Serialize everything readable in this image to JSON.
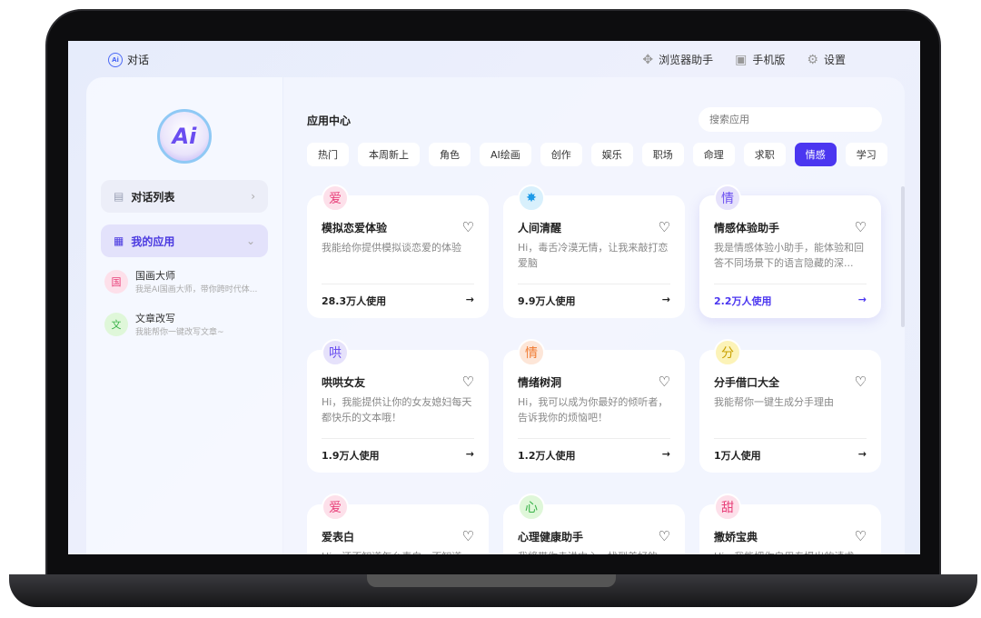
{
  "header": {
    "title": "对话",
    "logo_text": "Ai",
    "links": [
      {
        "label": "浏览器助手",
        "icon": "puzzle-icon"
      },
      {
        "label": "手机版",
        "icon": "phone-icon"
      },
      {
        "label": "设置",
        "icon": "gear-icon"
      }
    ]
  },
  "sidebar": {
    "logo_text": "Ai",
    "chat_list": "对话列表",
    "my_apps": "我的应用",
    "apps": [
      {
        "avatar": "国",
        "name": "国画大师",
        "desc": "我是AI国画大师，带你跨时代体...",
        "bg": "#fde0ea",
        "color": "#e8407a"
      },
      {
        "avatar": "文",
        "name": "文章改写",
        "desc": "我能帮你一键改写文章~",
        "bg": "#dff7d9",
        "color": "#3bb34a"
      }
    ]
  },
  "main": {
    "title": "应用中心",
    "search_placeholder": "搜索应用",
    "categories": [
      "热门",
      "本周新上",
      "角色",
      "AI绘画",
      "创作",
      "娱乐",
      "职场",
      "命理",
      "求职",
      "情感",
      "学习"
    ],
    "active_category": "情感",
    "cards": [
      {
        "icon": "爱",
        "bg": "#fde0ea",
        "color": "#e8407a",
        "title": "模拟恋爱体验",
        "desc": "我能给你提供模拟谈恋爱的体验",
        "usage": "28.3万人使用"
      },
      {
        "icon": "✸",
        "bg": "#d8f0fc",
        "color": "#1e9be8",
        "title": "人间清醒",
        "desc": "Hi，毒舌冷漠无情，让我来敲打恋爱脑",
        "usage": "9.9万人使用"
      },
      {
        "icon": "情",
        "bg": "#e6e2fb",
        "color": "#6a4df0",
        "title": "情感体验助手",
        "desc": "我是情感体验小助手，能体验和回答不同场景下的语言隐藏的深...",
        "usage": "2.2万人使用",
        "highlight": true
      },
      {
        "icon": "哄",
        "bg": "#e6e2fb",
        "color": "#6a4df0",
        "title": "哄哄女友",
        "desc": "Hi，我能提供让你的女友媳妇每天都快乐的文本哦！",
        "usage": "1.9万人使用"
      },
      {
        "icon": "情",
        "bg": "#fde6d8",
        "color": "#f07a30",
        "title": "情绪树洞",
        "desc": "Hi，我可以成为你最好的倾听者，告诉我你的烦恼吧！",
        "usage": "1.2万人使用"
      },
      {
        "icon": "分",
        "bg": "#fcf3b8",
        "color": "#c9a000",
        "title": "分手借口大全",
        "desc": "我能帮你一键生成分手理由",
        "usage": "1万人使用"
      },
      {
        "icon": "爱",
        "bg": "#fde0ea",
        "color": "#e8407a",
        "title": "爱表白",
        "desc": "Hi，还不知道怎么表白，不知道...",
        "usage": ""
      },
      {
        "icon": "心",
        "bg": "#dff7d9",
        "color": "#3bb34a",
        "title": "心理健康助手",
        "desc": "我将带你走进内心，找到美好的...",
        "usage": ""
      },
      {
        "icon": "甜",
        "bg": "#fde0ea",
        "color": "#e8407a",
        "title": "撒娇宝典",
        "desc": "Hi，我能把你自用专提出的请求...",
        "usage": ""
      }
    ]
  }
}
